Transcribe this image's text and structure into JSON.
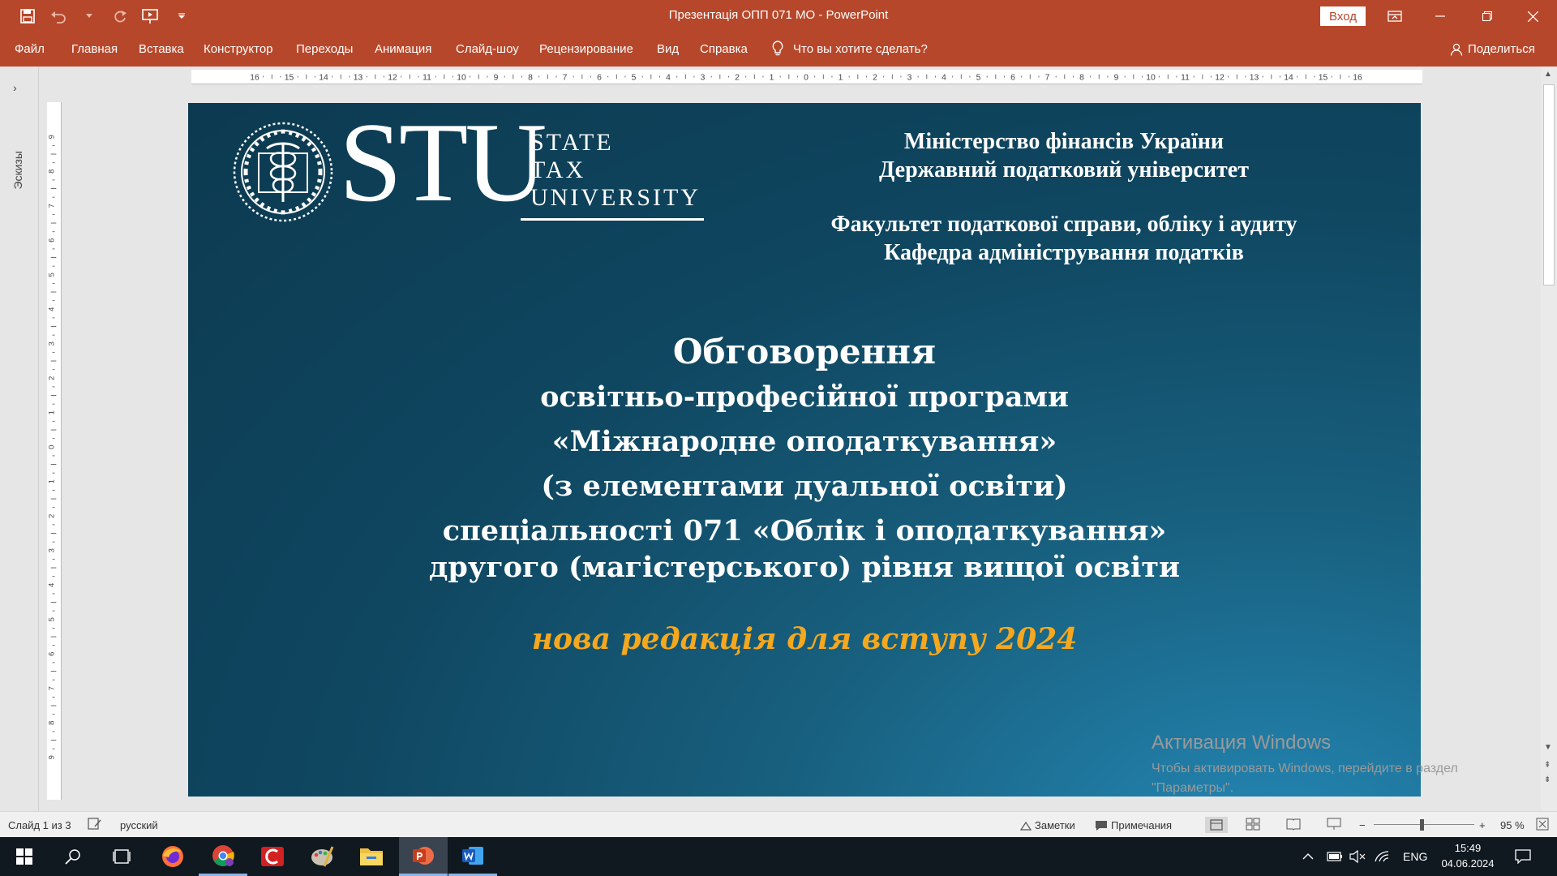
{
  "app": {
    "window_title": "Презентація ОПП 071 МО  -  PowerPoint",
    "login_label": "Вход",
    "colors": {
      "accent": "#b7472a",
      "slide_edition": "#f5a81e"
    }
  },
  "ribbon": {
    "tabs": [
      "Файл",
      "Главная",
      "Вставка",
      "Конструктор",
      "Переходы",
      "Анимация",
      "Слайд-шоу",
      "Рецензирование",
      "Вид",
      "Справка"
    ],
    "tell_me": "Что вы хотите сделать?",
    "share": "Поделиться"
  },
  "sidebar": {
    "label": "Эскизы"
  },
  "rulers": {
    "horizontal": [
      "16",
      "15",
      "14",
      "13",
      "12",
      "11",
      "10",
      "9",
      "8",
      "7",
      "6",
      "5",
      "4",
      "3",
      "2",
      "1",
      "0",
      "1",
      "2",
      "3",
      "4",
      "5",
      "6",
      "7",
      "8",
      "9",
      "10",
      "11",
      "12",
      "13",
      "14",
      "15",
      "16"
    ],
    "vertical": [
      "9",
      "8",
      "7",
      "6",
      "5",
      "4",
      "3",
      "2",
      "1",
      "0",
      "1",
      "2",
      "3",
      "4",
      "5",
      "6",
      "7",
      "8",
      "9"
    ]
  },
  "slide": {
    "logo_letters": "STU",
    "logo_words": [
      "STATE",
      "TAX",
      "UNIVERSITY"
    ],
    "ministry": [
      "Міністерство фінансів України",
      "Державний податковий університет"
    ],
    "faculty": [
      "Факультет податкової справи, обліку і аудиту",
      "Кафедра адміністрування податків"
    ],
    "title_lines": [
      "Обговорення",
      "освітньо-професійної програми",
      "«Міжнародне оподаткування»",
      "(з елементами дуальної освіти)",
      "спеціальності 071 «Облік і оподаткування»",
      "другого (магістерського) рівня вищої освіти"
    ],
    "edition": "нова редакція для вступу 2024"
  },
  "watermark": {
    "title": "Активация Windows",
    "line1": "Чтобы активировать Windows, перейдите в раздел",
    "line2": "\"Параметры\"."
  },
  "status": {
    "slide_counter": "Слайд 1 из 3",
    "language": "русский",
    "notes": "Заметки",
    "comments": "Примечания",
    "zoom": "95 %"
  },
  "taskbar": {
    "lang": "ENG",
    "time": "15:49",
    "date": "04.06.2024"
  }
}
